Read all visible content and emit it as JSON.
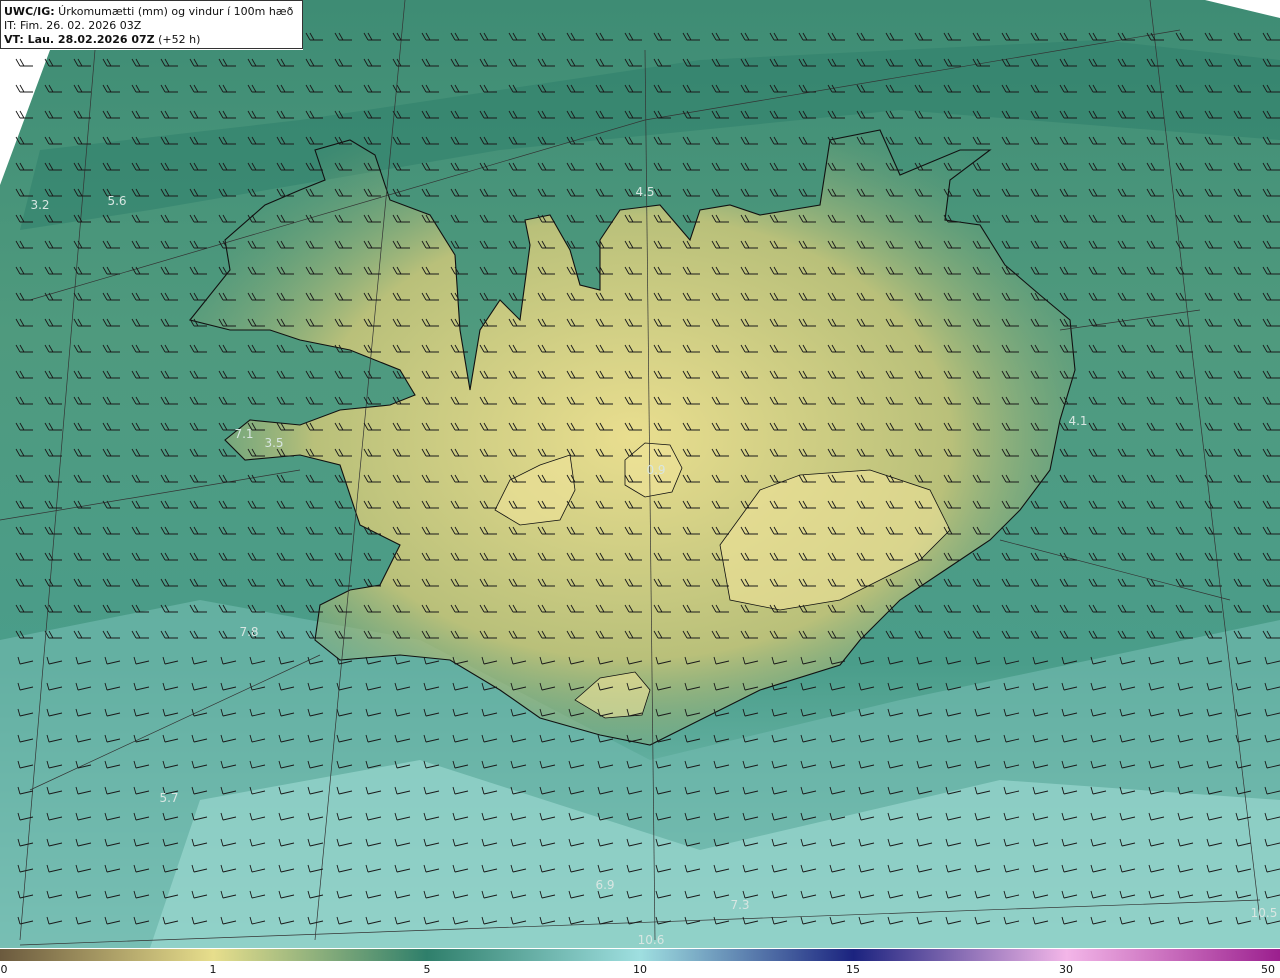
{
  "header": {
    "product": "UWC/IG:",
    "title": " Úrkomumætti (mm) og vindur í 100m hæð",
    "init_time": "IT: Fim. 26. 02. 2026 03Z",
    "valid_prefix": "VT: Lau. 28.02.2026 07Z",
    "valid_suffix": " (+52 h)"
  },
  "colors": {
    "low": "#6b5a3e",
    "mid_yellow": "#e7de8c",
    "green": "#2f7f6b",
    "teal": "#8fd3cc",
    "blue": "#1b237f",
    "purple": "#9b1f8e",
    "coast": "#111111"
  },
  "value_labels": [
    {
      "text": "3.2"
    },
    {
      "text": "5.6"
    },
    {
      "text": "4.5"
    },
    {
      "text": "7.1"
    },
    {
      "text": "3.5"
    },
    {
      "text": "0.9"
    },
    {
      "text": "4.1"
    },
    {
      "text": "7.8"
    },
    {
      "text": "5.7"
    },
    {
      "text": "6.9"
    },
    {
      "text": "7.3"
    },
    {
      "text": "10.6"
    },
    {
      "text": "10.5"
    }
  ],
  "colorbar": {
    "ticks": [
      "0",
      "1",
      "5",
      "10",
      "15",
      "30",
      "50"
    ]
  }
}
